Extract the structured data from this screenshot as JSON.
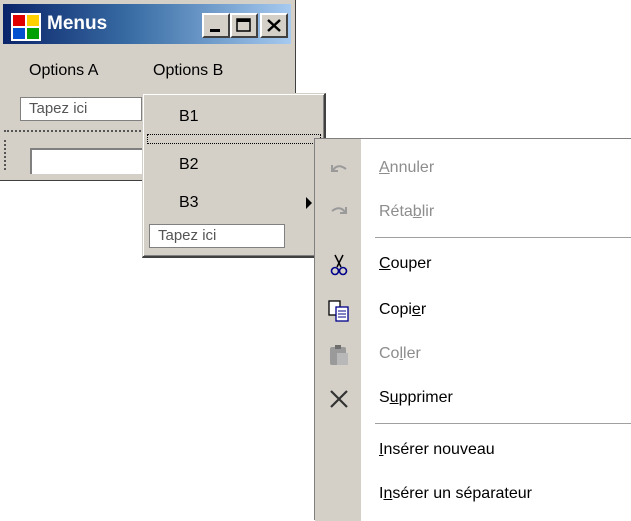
{
  "window": {
    "title": "Menus"
  },
  "menubar": {
    "items": [
      "Options A",
      "Options B"
    ],
    "placeholder": "Tapez ici"
  },
  "dropdown": {
    "items": [
      "B1",
      "B2",
      "B3"
    ],
    "placeholder": "Tapez ici"
  },
  "context_menu": {
    "undo": {
      "pre": "",
      "u": "A",
      "post": "nnuler",
      "disabled": true,
      "icon": "undo-icon"
    },
    "redo": {
      "pre": "Réta",
      "u": "b",
      "post": "lir",
      "disabled": true,
      "icon": "redo-icon"
    },
    "cut": {
      "pre": "",
      "u": "C",
      "post": "ouper",
      "disabled": false,
      "icon": "scissors-icon"
    },
    "copy": {
      "pre": "Copi",
      "u": "e",
      "post": "r",
      "disabled": false,
      "icon": "copy-icon"
    },
    "paste": {
      "pre": "Co",
      "u": "l",
      "post": "ler",
      "disabled": true,
      "icon": "paste-icon"
    },
    "delete": {
      "pre": "S",
      "u": "u",
      "post": "pprimer",
      "disabled": false,
      "icon": "delete-icon"
    },
    "insert_new": {
      "pre": "",
      "u": "I",
      "post": "nsérer nouveau",
      "disabled": false
    },
    "insert_sep": {
      "pre": "I",
      "u": "n",
      "post": "sérer un séparateur",
      "disabled": false
    }
  },
  "colors": {
    "titlebar_start": "#0a246a",
    "titlebar_end": "#a6caf0",
    "face": "#d4d0c8",
    "disabled_text": "#8d8d8d"
  }
}
